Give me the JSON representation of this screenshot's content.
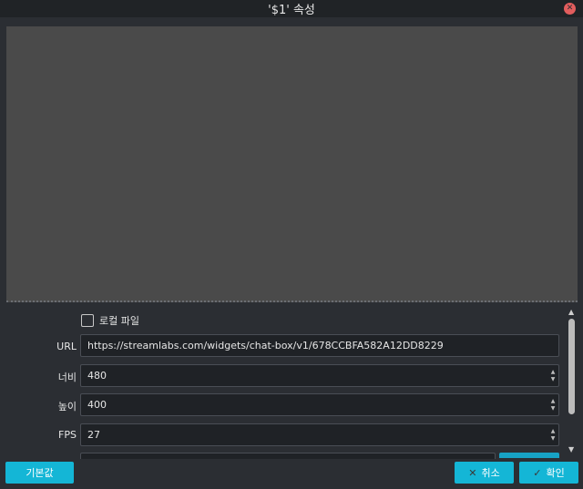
{
  "window": {
    "title": "'$1' 속성"
  },
  "form": {
    "local_file": {
      "label": "로컬 파일",
      "checked": false
    },
    "url": {
      "label": "URL",
      "value": "https://streamlabs.com/widgets/chat-box/v1/678CCBFA582A12DD8229"
    },
    "width": {
      "label": "너비",
      "value": "480"
    },
    "height": {
      "label": "높이",
      "value": "400"
    },
    "fps": {
      "label": "FPS",
      "value": "27"
    }
  },
  "footer": {
    "defaults_label": "기본값",
    "cancel_label": "취소",
    "ok_label": "확인"
  },
  "icons": {
    "close": "close-icon",
    "spin_up": "▲",
    "spin_down": "▼",
    "scroll_up": "▲",
    "scroll_down": "▼",
    "cancel": "✕",
    "ok": "✓"
  },
  "colors": {
    "accent": "#14b6d6",
    "close": "#e25d5d"
  }
}
